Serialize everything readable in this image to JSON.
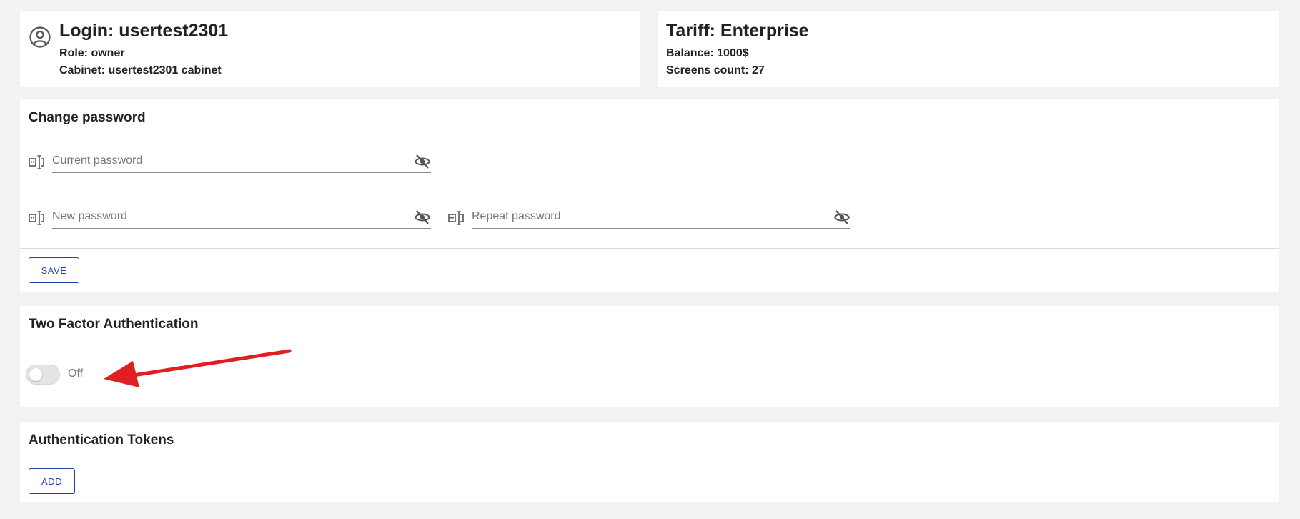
{
  "user": {
    "login": "Login: usertest2301",
    "role": "Role: owner",
    "cabinet": "Cabinet: usertest2301 cabinet"
  },
  "tariff": {
    "title": "Tariff: Enterprise",
    "balance": "Balance: 1000$",
    "screens": "Screens count: 27"
  },
  "change_password": {
    "title": "Change password",
    "current_placeholder": "Current password",
    "new_placeholder": "New password",
    "repeat_placeholder": "Repeat password",
    "save_label": "SAVE"
  },
  "two_factor": {
    "title": "Two Factor Authentication",
    "state_label": "Off",
    "enabled": false
  },
  "tokens": {
    "title": "Authentication Tokens",
    "add_label": "ADD"
  },
  "colors": {
    "accent": "#2a3ea8",
    "arrow": "#e02020",
    "background": "#f2f2f2"
  },
  "icons": {
    "user": "user-circle-icon",
    "password_field": "password-field-icon",
    "visibility": "eye-off-icon",
    "annotation": "red-arrow-icon"
  }
}
